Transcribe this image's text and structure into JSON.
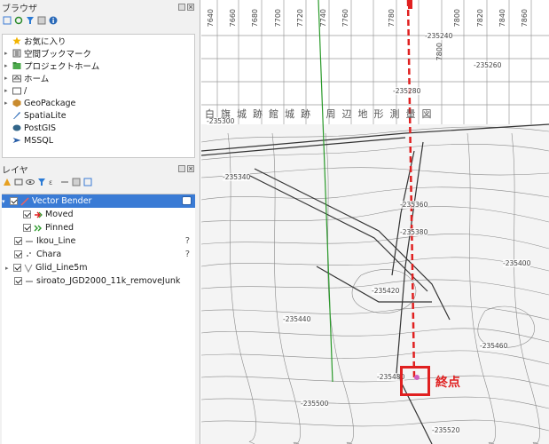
{
  "browser": {
    "title": "ブラウザ",
    "items": [
      {
        "label": "お気に入り",
        "icon": "star-icon",
        "color": "#f2b400"
      },
      {
        "label": "空間ブックマーク",
        "icon": "bookmark-icon",
        "color": "#555555"
      },
      {
        "label": "プロジェクトホーム",
        "icon": "project-home-icon",
        "color": "#3a8a3a"
      },
      {
        "label": "ホーム",
        "icon": "home-folder-icon",
        "color": "#666666"
      },
      {
        "label": "/",
        "icon": "root-folder-icon",
        "color": "#666666"
      },
      {
        "label": "GeoPackage",
        "icon": "geopackage-icon",
        "color": "#c98b2e"
      },
      {
        "label": "SpatiaLite",
        "icon": "spatialite-icon",
        "color": "#2a6ab8"
      },
      {
        "label": "PostGIS",
        "icon": "postgis-icon",
        "color": "#33668a"
      },
      {
        "label": "MSSQL",
        "icon": "mssql-icon",
        "color": "#2a5fa8"
      }
    ]
  },
  "layers": {
    "title": "レイヤ",
    "items": [
      {
        "label": "Vector Bender",
        "selected": true
      },
      {
        "label": "Moved"
      },
      {
        "label": "Pinned"
      },
      {
        "label": "Ikou_Line",
        "mark": "?"
      },
      {
        "label": "Chara",
        "mark": "?"
      },
      {
        "label": "Glid_Line5m"
      },
      {
        "label": "siroato_JGD2000_11k_removeJunk"
      }
    ]
  },
  "map": {
    "top_ticks": [
      "7640",
      "7660",
      "7680",
      "7700",
      "7720",
      "7740",
      "7760",
      "7780",
      "7800",
      "7820",
      "7840",
      "7860"
    ],
    "inner_tick": "7800",
    "coords": {
      "c1": "-235240",
      "c2": "-235260",
      "c3": "-235280",
      "c4": "-235300",
      "c5": "-235340",
      "c6": "-235360",
      "c7": "-235380",
      "c8": "-235400",
      "c9": "-235420",
      "c10": "-235440",
      "c11": "-235460",
      "c12": "-235480",
      "c13": "-235500",
      "c14": "-235520"
    },
    "title_text": "白旗城跡館城跡 周辺地形測量図",
    "endpoint_label": "終点",
    "colors": {
      "route": "#e02020",
      "green_line": "#2a9a2a"
    }
  }
}
